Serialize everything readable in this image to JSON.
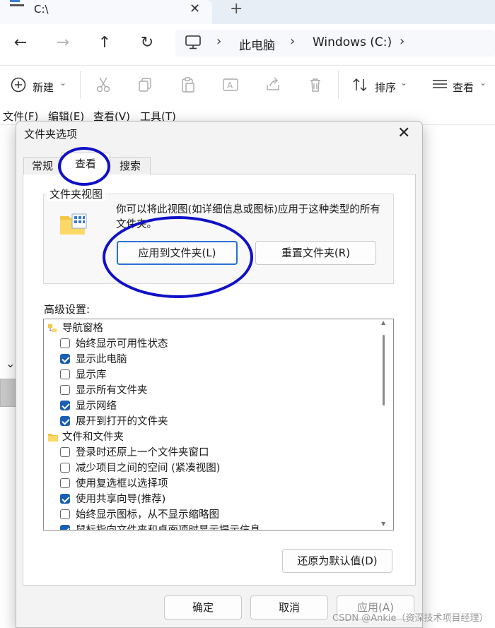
{
  "window": {
    "tab_title": "C:\\",
    "tab_close": "✕",
    "new_tab": "+"
  },
  "nav": {
    "back": "←",
    "forward": "→",
    "up": "↑",
    "refresh": "↻",
    "breadcrumb": [
      "此电脑",
      "Windows (C:)"
    ],
    "separator": "›"
  },
  "toolbar": {
    "new_label": "新建",
    "sort_label": "排序",
    "view_label": "查看",
    "dropdown": "⌄"
  },
  "menubar": [
    "文件(F)",
    "编辑(E)",
    "查看(V)",
    "工具(T)"
  ],
  "dialog": {
    "title": "文件夹选项",
    "close": "✕",
    "tabs": [
      "常规",
      "查看",
      "搜索"
    ],
    "active_tab": "查看",
    "folder_views": {
      "title": "文件夹视图",
      "description": "你可以将此视图(如详细信息或图标)应用于这种类型的所有文件夹。",
      "apply_button": "应用到文件夹(L)",
      "reset_button": "重置文件夹(R)"
    },
    "advanced_label": "高级设置:",
    "advanced_items": [
      {
        "type": "group",
        "icon": "navigation-pane-icon",
        "label": "导航窗格"
      },
      {
        "type": "check",
        "checked": false,
        "label": "始终显示可用性状态"
      },
      {
        "type": "check",
        "checked": true,
        "label": "显示此电脑"
      },
      {
        "type": "check",
        "checked": false,
        "label": "显示库"
      },
      {
        "type": "check",
        "checked": false,
        "label": "显示所有文件夹"
      },
      {
        "type": "check",
        "checked": true,
        "label": "显示网络"
      },
      {
        "type": "check",
        "checked": true,
        "label": "展开到打开的文件夹"
      },
      {
        "type": "group",
        "icon": "folder-icon",
        "label": "文件和文件夹"
      },
      {
        "type": "check",
        "checked": false,
        "label": "登录时还原上一个文件夹窗口"
      },
      {
        "type": "check",
        "checked": false,
        "label": "减少项目之间的空间 (紧凑视图)"
      },
      {
        "type": "check",
        "checked": false,
        "label": "使用复选框以选择项"
      },
      {
        "type": "check",
        "checked": true,
        "label": "使用共享向导(推荐)"
      },
      {
        "type": "check",
        "checked": false,
        "label": "始终显示图标，从不显示缩略图"
      },
      {
        "type": "check",
        "checked": true,
        "label": "鼠标指向文件夹和桌面项时显示提示信息"
      }
    ],
    "restore_defaults": "还原为默认值(D)",
    "ok": "确定",
    "cancel": "取消",
    "apply": "应用(A)"
  },
  "watermark": "CSDN @Ankie（资深技术项目经理）",
  "colors": {
    "annotation": "#1010c8",
    "checkbox_on": "#1a5fb4",
    "focus_border": "#2a6fd3"
  }
}
